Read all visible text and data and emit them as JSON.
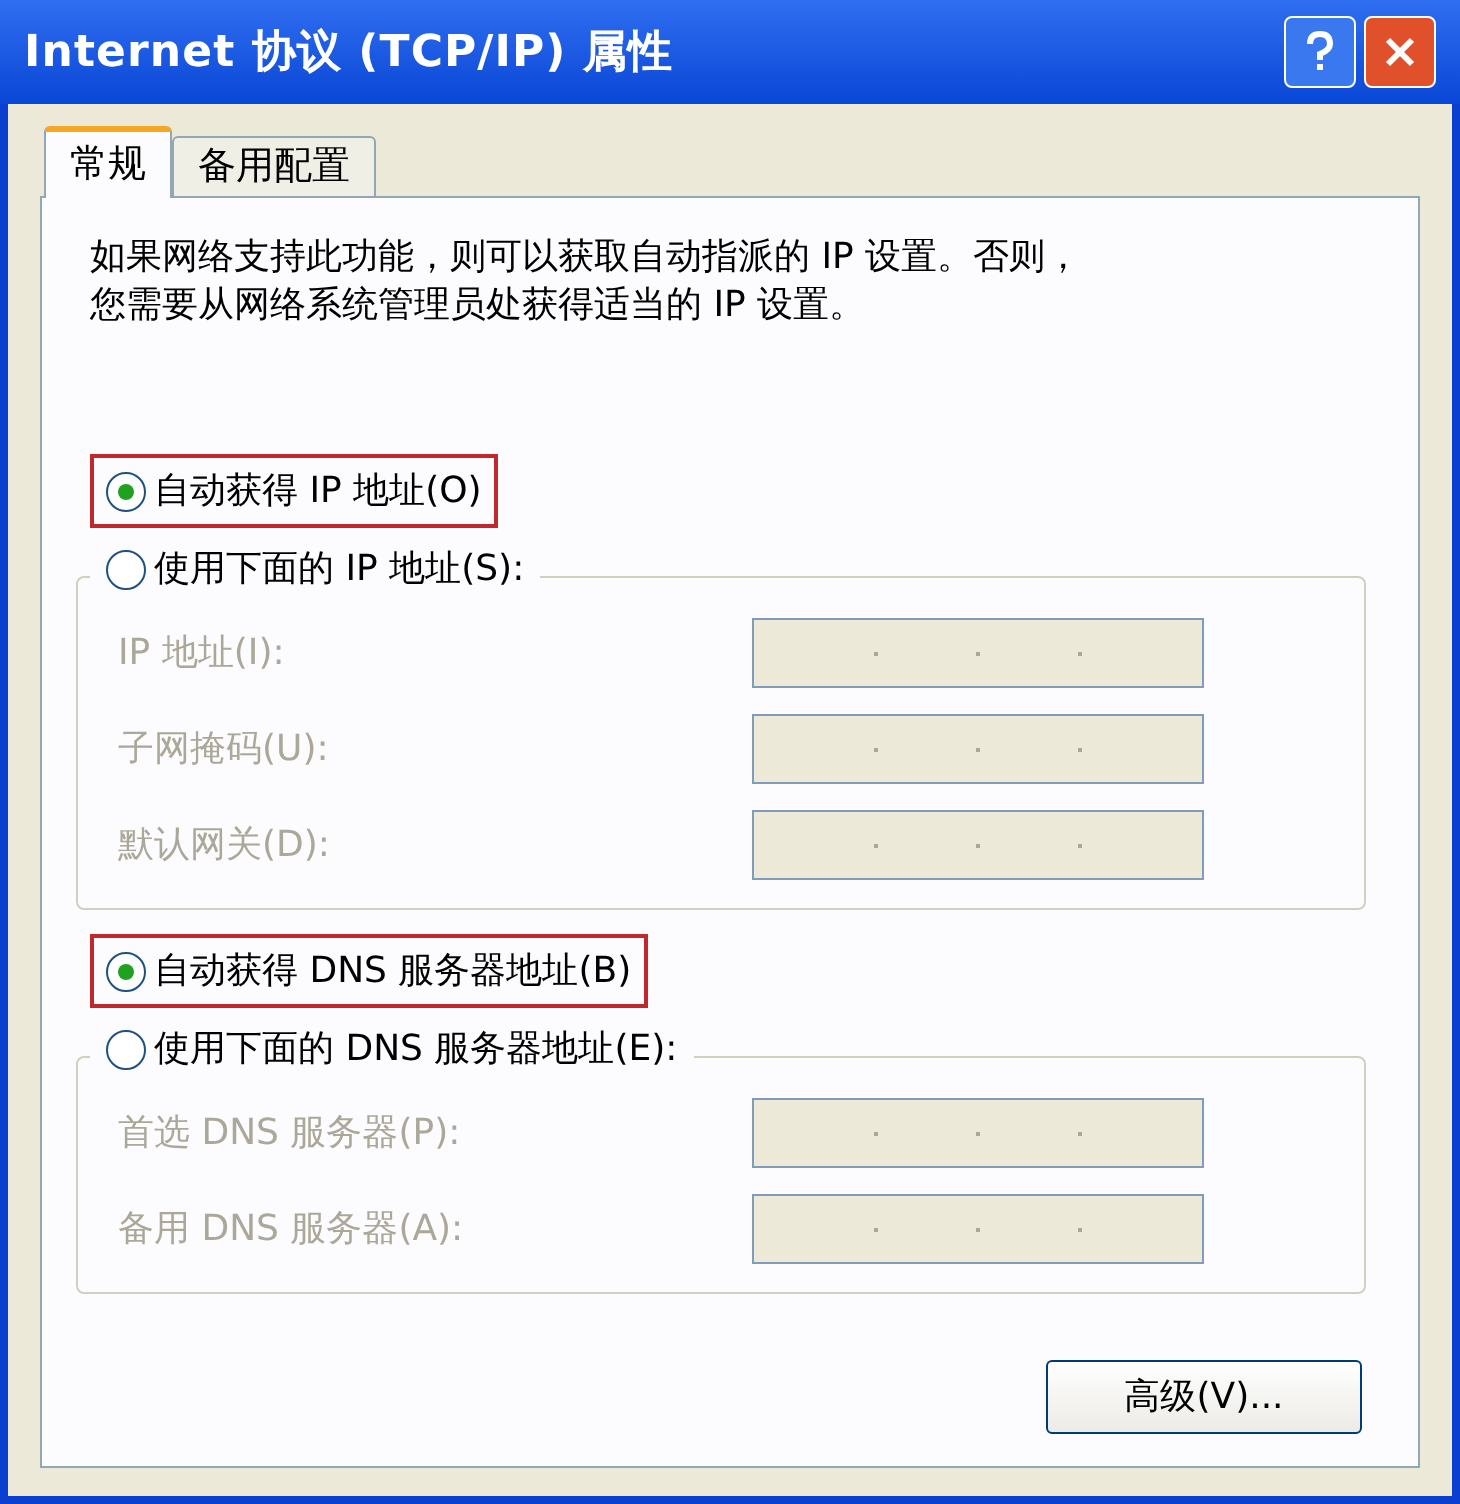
{
  "window": {
    "title": "Internet 协议 (TCP/IP) 属性"
  },
  "tabs": [
    {
      "label": "常规",
      "selected": true
    },
    {
      "label": "备用配置",
      "selected": false
    }
  ],
  "description_lines": [
    "如果网络支持此功能，则可以获取自动指派的 IP 设置。否则，",
    "您需要从网络系统管理员处获得适当的 IP 设置。"
  ],
  "ip": {
    "auto": {
      "label": "自动获得 IP 地址(O)",
      "selected": true,
      "highlighted": true
    },
    "manual": {
      "label": "使用下面的 IP 地址(S):",
      "selected": false,
      "highlighted": false
    },
    "fields": [
      {
        "label": "IP 地址(I):",
        "disabled": true
      },
      {
        "label": "子网掩码(U):",
        "disabled": true
      },
      {
        "label": "默认网关(D):",
        "disabled": true
      }
    ]
  },
  "dns": {
    "auto": {
      "label": "自动获得 DNS 服务器地址(B)",
      "selected": true,
      "highlighted": true
    },
    "manual": {
      "label": "使用下面的 DNS 服务器地址(E):",
      "selected": false,
      "highlighted": false
    },
    "fields": [
      {
        "label": "首选 DNS 服务器(P):",
        "disabled": true
      },
      {
        "label": "备用 DNS 服务器(A):",
        "disabled": true
      }
    ]
  },
  "buttons": [
    {
      "label": "高级(V)..."
    }
  ]
}
